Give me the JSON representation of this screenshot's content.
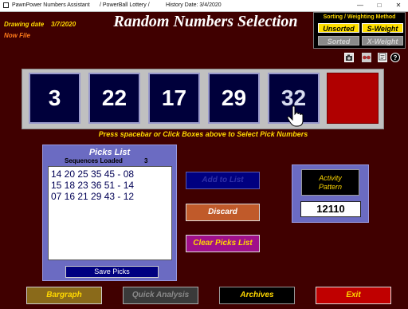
{
  "window": {
    "app_title": "PawnPower Numbers Assistant",
    "lottery_title": "/ PowerBall Lottery /",
    "history_date": "History Date: 3/4/2020"
  },
  "header": {
    "drawing_date_label": "Drawing date",
    "drawing_date_value": "3/7/2020",
    "file_label": "Now File",
    "title": "Random Numbers Selection"
  },
  "sort_panel": {
    "title": "Sorting / Weighting Method",
    "unsorted": "Unsorted",
    "s_weight": "S-Weight",
    "sorted": "Sorted",
    "x_weight": "X-Weight"
  },
  "numbers": [
    "3",
    "22",
    "17",
    "29",
    "32"
  ],
  "prompt": "Press spacebar or Click Boxes above to Select Pick Numbers",
  "picks_list": {
    "title": "Picks List",
    "sequences_label": "Sequences Loaded",
    "sequences_count": "3",
    "rows": [
      "14 20 25 35 45 - 08",
      "15 18 23 36 51 - 14",
      "07 16 21 29 43 - 12"
    ],
    "save_label": "Save Picks"
  },
  "actions": {
    "add_to_list": "Add to List",
    "discard": "Discard",
    "clear_picks": "Clear Picks List"
  },
  "activity": {
    "label_line1": "Activity",
    "label_line2": "Pattern",
    "value": "12110"
  },
  "bottom": {
    "bargraph": "Bargraph",
    "quick_analysis": "Quick Analysis",
    "archives": "Archives",
    "exit": "Exit"
  },
  "colors": {
    "background": "#400000",
    "number_box": "#00003b",
    "empty_powerball_box": "#b00000",
    "label_yellow": "#ffd800",
    "panel_purple": "#6b6bc2"
  }
}
